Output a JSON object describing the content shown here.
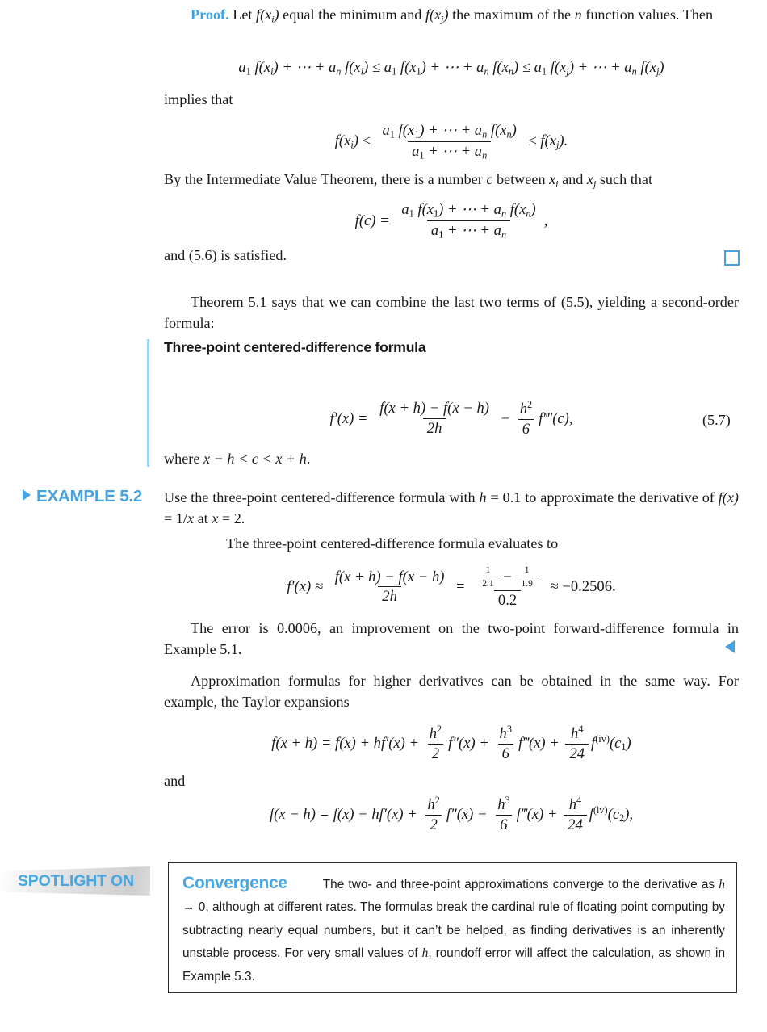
{
  "colors": {
    "accent_blue": "#45a4e0",
    "rule_blue": "#9ed5f2",
    "spotlight_blue": "#48a6e2",
    "text": "#1a1a1a",
    "box_border": "#2b2b2b"
  },
  "proof": {
    "label": "Proof.",
    "line1_a": "Let ",
    "line1_b": " equal the minimum and ",
    "line1_c": " the maximum of the ",
    "line1_d": " function values. Then",
    "fx_i": "f(xᵢ)",
    "fx_j": "f(xⱼ)",
    "n": "n",
    "implies_that": "implies that",
    "ivt_a": "By the Intermediate Value Theorem, there is a number ",
    "ivt_c": "c",
    "ivt_b": " between ",
    "ivt_xi": "xᵢ",
    "ivt_and": " and ",
    "ivt_xj": "xⱼ",
    "ivt_d": " such that",
    "and_satisfied": "and (5.6) is satisfied.",
    "qed_icon": "open-square-icon"
  },
  "theorem_note": {
    "text": "Theorem 5.1 says that we can combine the last two terms of (5.5), yielding a second-order formula:"
  },
  "formula_box": {
    "heading": "Three-point centered-difference formula",
    "where": "where x − h < c < x + h.",
    "eq_number": "(5.7)"
  },
  "example": {
    "label": "EXAMPLE 5.2",
    "marker_icon": "triangle-right-icon",
    "end_marker_icon": "triangle-left-icon",
    "statement_1": "Use the three-point centered-difference formula with ",
    "statement_h": "h = 0.1",
    "statement_2": " to approximate the derivative of ",
    "statement_f": "f(x) = 1/x",
    "statement_3": " at ",
    "statement_x": "x = 2",
    "statement_4": ".",
    "evaluates": "The three-point centered-difference formula evaluates to",
    "result_value": "−0.2506",
    "numer_left": "1",
    "numer_left_den": "2.1",
    "numer_right": "1",
    "numer_right_den": "1.9",
    "denom": "0.2",
    "error_text": "The error is 0.0006, an improvement on the two-point forward-difference formula in Example 5.1."
  },
  "taylor": {
    "intro": "Approximation formulas for higher derivatives can be obtained in the same way. For example, the Taylor expansions",
    "and": "and",
    "c1": "c₁",
    "c2": "c₂",
    "coef2": "2",
    "coef6": "6",
    "coef24": "24"
  },
  "spotlight": {
    "band_label": "SPOTLIGHT ON",
    "title": "Convergence",
    "body_1": "The two- and three-point approximations converge to the derivative as ",
    "body_h": "h",
    "body_2": " → 0, although at different rates. The formulas break the cardinal rule of floating point computing by subtracting nearly equal numbers, but it can’t be helped, as finding derivatives is an inherently unstable process. For very small values of ",
    "body_h2": "h",
    "body_3": ", roundoff error will affect the calculation, as shown in Example 5.3."
  }
}
